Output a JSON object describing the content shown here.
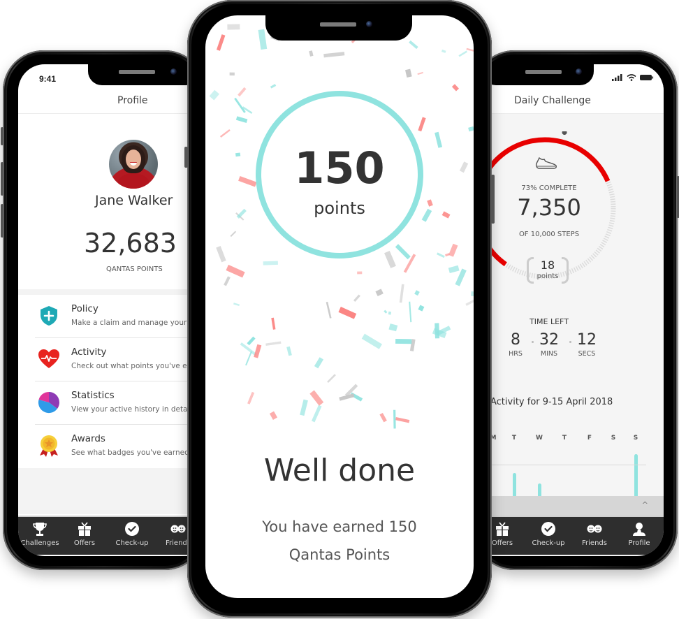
{
  "left_phone": {
    "status_time": "9:41",
    "title": "Profile",
    "user_name": "Jane Walker",
    "points": "32,683",
    "points_label": "QANTAS POINTS",
    "menu": [
      {
        "icon": "shield-plus-icon",
        "title": "Policy",
        "subtitle": "Make a claim and manage your policy",
        "color": "#1ea9b5"
      },
      {
        "icon": "heart-pulse-icon",
        "title": "Activity",
        "subtitle": "Check out what points you've earned",
        "color": "#e8231f"
      },
      {
        "icon": "pie-chart-icon",
        "title": "Statistics",
        "subtitle": "View your active history in detail",
        "color": "#8e3bb5"
      },
      {
        "icon": "award-medal-icon",
        "title": "Awards",
        "subtitle": "See what badges you've earned",
        "color": "#f2c02b"
      }
    ],
    "tabs": [
      {
        "icon": "trophy-icon",
        "label": "Challenges"
      },
      {
        "icon": "gift-icon",
        "label": "Offers"
      },
      {
        "icon": "check-circle-icon",
        "label": "Check-up"
      },
      {
        "icon": "friends-icon",
        "label": "Friends"
      }
    ]
  },
  "center_phone": {
    "points_value": "150",
    "points_word": "points",
    "headline": "Well done",
    "message_line1": "You have earned 150",
    "message_line2": "Qantas Points",
    "accent_color": "#8fe3df",
    "confetti_colors": [
      "#8fe3df",
      "#fb8583",
      "#c6c6c6"
    ]
  },
  "right_phone": {
    "title": "Daily Challenge",
    "progress_fraction": 0.73,
    "percent_label": "73% COMPLETE",
    "steps": "7,350",
    "steps_of": "OF 10,000 STEPS",
    "reward_points": "18",
    "reward_word": "points",
    "time_left_label": "TIME LEFT",
    "countdown": [
      {
        "value": "8",
        "unit": "HRS"
      },
      {
        "value": "32",
        "unit": "MINS"
      },
      {
        "value": "12",
        "unit": "SECS"
      }
    ],
    "activity_title": "Activity for 9-15 April 2018",
    "drawer_chevron": "^",
    "ring_color": "#e80000",
    "tabs": [
      {
        "icon": "gift-icon",
        "label": "Offers"
      },
      {
        "icon": "check-circle-icon",
        "label": "Check-up"
      },
      {
        "icon": "friends-icon",
        "label": "Friends"
      },
      {
        "icon": "profile-icon",
        "label": "Profile"
      }
    ]
  },
  "chart_data": {
    "type": "bar",
    "title": "Activity for 9-15 April 2018",
    "categories": [
      "M",
      "T",
      "W",
      "T",
      "F",
      "S",
      "S"
    ],
    "values": [
      null,
      0.55,
      0.3,
      0,
      0,
      0,
      1.0
    ],
    "goal_line": 0.75,
    "xlabel": "",
    "ylabel": "",
    "note": "values relative to visible chart height; Monday bar cropped out of view"
  }
}
